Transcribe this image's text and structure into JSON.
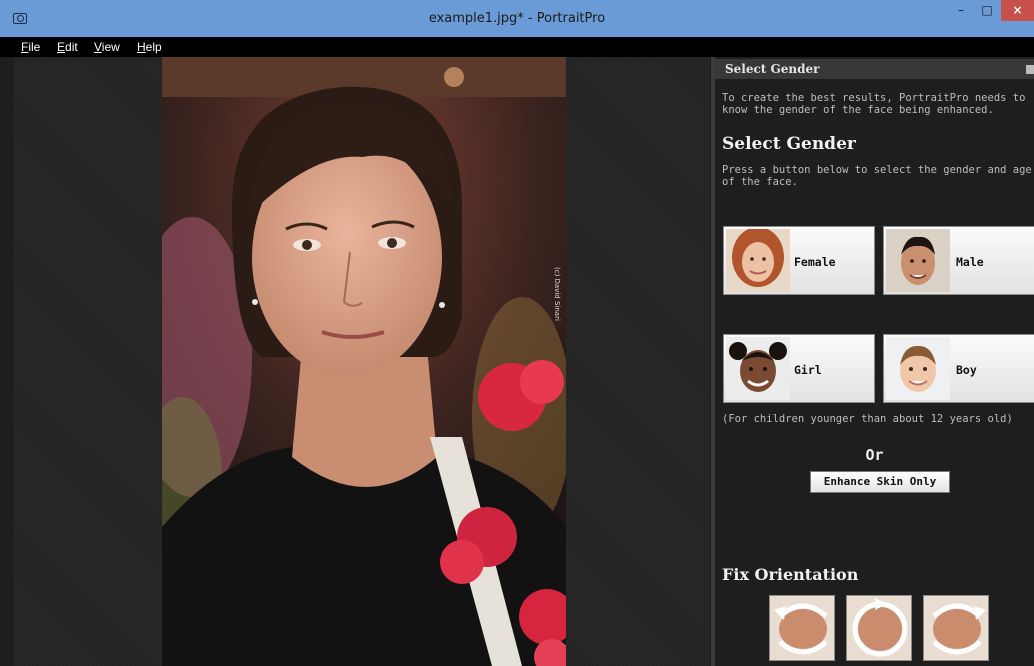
{
  "window": {
    "title": "example1.jpg* - PortraitPro",
    "app_icon": "camera-icon",
    "controls": {
      "minimize": "–",
      "maximize": "□",
      "close": "×"
    }
  },
  "menu": [
    {
      "first": "F",
      "rest": "ile"
    },
    {
      "first": "E",
      "rest": "dit"
    },
    {
      "first": "V",
      "rest": "iew"
    },
    {
      "first": "H",
      "rest": "elp"
    }
  ],
  "photo": {
    "credit": "(c) David Sinari",
    "description_icon": "portrait-photo"
  },
  "panel": {
    "header": "Select Gender",
    "pin_icon": "pin-icon",
    "intro": "To create the best results, PortraitPro needs to know the gender of the face being enhanced.",
    "heading": "Select Gender",
    "instruction": "Press a button below to select the gender and age of the face.",
    "buttons": {
      "female": "Female",
      "male": "Male",
      "girl": "Girl",
      "boy": "Boy"
    },
    "children_note": "(For children younger than about 12 years old)",
    "or": "Or",
    "skin_only": "Enhance Skin Only",
    "orientation_heading": "Fix Orientation"
  },
  "colors": {
    "titlebar": "#6b9bd6",
    "close_button": "#c7504b",
    "panel_bg": "#1e1e1e",
    "panel_header": "#383838"
  }
}
